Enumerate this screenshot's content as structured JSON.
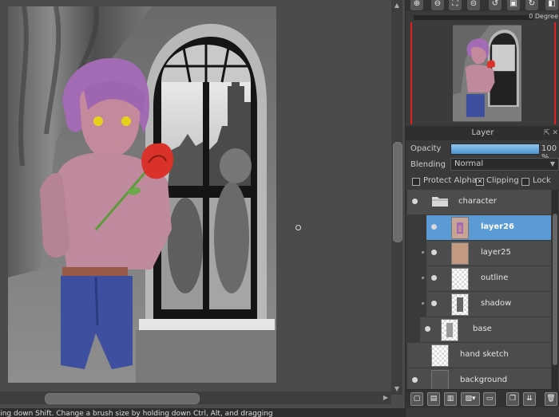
{
  "status_text": "lding down Shift. Change a brush size by holding down Ctrl, Alt, and dragging",
  "navigator": {
    "rotation": "0 Degree"
  },
  "layer_panel": {
    "title": "Layer",
    "opacity_label": "Opacity",
    "opacity_value": "100 %",
    "opacity_fraction": 1.0,
    "blending_label": "Blending",
    "blending_value": "Normal",
    "protect_alpha_label": "Protect Alpha",
    "clipping_label": "Clipping",
    "lock_label": "Lock",
    "clipping_checked": true
  },
  "layers": [
    {
      "name": "character"
    },
    {
      "name": "layer26"
    },
    {
      "name": "layer25"
    },
    {
      "name": "outline"
    },
    {
      "name": "shadow"
    },
    {
      "name": "base"
    },
    {
      "name": "hand sketch"
    },
    {
      "name": "background"
    }
  ],
  "colors": {
    "selected_layer": "#5a9bd6",
    "accent_red": "#e02020",
    "panel_bg": "#3a3a3a"
  }
}
